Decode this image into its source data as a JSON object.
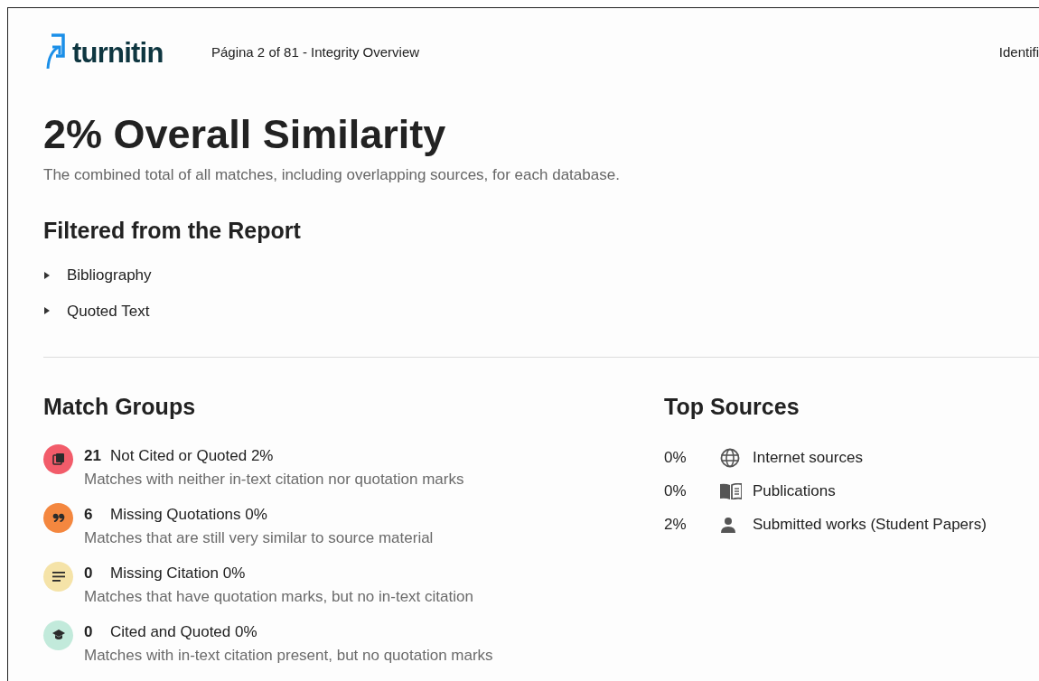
{
  "header": {
    "logo_text": "turnitin",
    "page_info": "Página 2 of 81 - Integrity Overview",
    "right_text": "Identifi"
  },
  "title": "2% Overall Similarity",
  "subtitle": "The combined total of all matches, including overlapping sources, for each database.",
  "filtered": {
    "heading": "Filtered from the Report",
    "items": [
      {
        "label": "Bibliography",
        "expanded": false
      },
      {
        "label": "Quoted Text",
        "expanded": false
      }
    ]
  },
  "match_groups": {
    "heading": "Match Groups",
    "items": [
      {
        "kind": "copy",
        "color": "#f25c6a",
        "count": "21",
        "label": "Not Cited or Quoted 2%",
        "description": "Matches with neither in-text citation nor quotation marks"
      },
      {
        "kind": "quote",
        "color": "#f4873f",
        "count": "6",
        "label": "Missing Quotations 0%",
        "description": "Matches that are still very similar to source material"
      },
      {
        "kind": "lines",
        "color": "#f5e3a8",
        "count": "0",
        "label": "Missing Citation 0%",
        "description": "Matches that have quotation marks, but no in-text citation"
      },
      {
        "kind": "cap",
        "color": "#c2eadb",
        "count": "0",
        "label": "Cited and Quoted 0%",
        "description": "Matches with in-text citation present, but no quotation marks"
      }
    ]
  },
  "top_sources": {
    "heading": "Top Sources",
    "items": [
      {
        "kind": "internet",
        "percent": "0%",
        "label": "Internet sources"
      },
      {
        "kind": "publications",
        "percent": "0%",
        "label": "Publications"
      },
      {
        "kind": "student",
        "percent": "2%",
        "label": "Submitted works (Student Papers)"
      }
    ]
  }
}
